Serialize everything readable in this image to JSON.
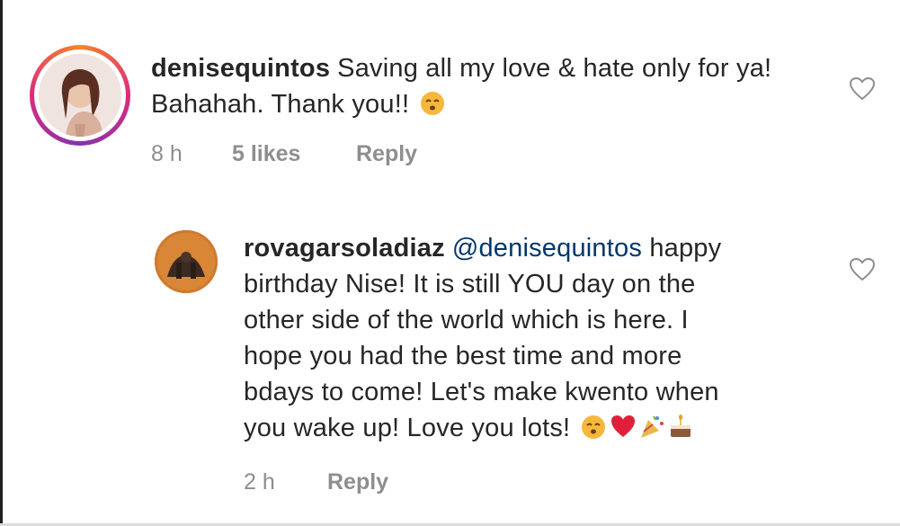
{
  "comments": [
    {
      "username": "denisequintos",
      "text": "Saving all my love & hate only for ya! Bahahah. Thank you!!",
      "time": "8 h",
      "likes": "5 likes",
      "reply_label": "Reply",
      "emoji_icons": [
        "face-emoji"
      ]
    }
  ],
  "replies": [
    {
      "username": "rovagarsoladiaz",
      "mention": "@denisequintos",
      "text_lines": [
        "happy",
        "birthday Nise! It is still YOU day on the",
        "other side of the world which is here. I",
        "hope you had the best time and more",
        "bdays to come! Let's make kwento when",
        "you wake up! Love you lots!"
      ],
      "time": "2 h",
      "reply_label": "Reply",
      "emoji_icons": [
        "face-emoji",
        "red-heart-emoji",
        "party-popper-emoji",
        "birthday-cake-emoji"
      ]
    }
  ],
  "colors": {
    "text": "#262626",
    "meta": "#8e8e8e",
    "mention": "#00376b",
    "heart_stroke": "#8e8e8e"
  }
}
